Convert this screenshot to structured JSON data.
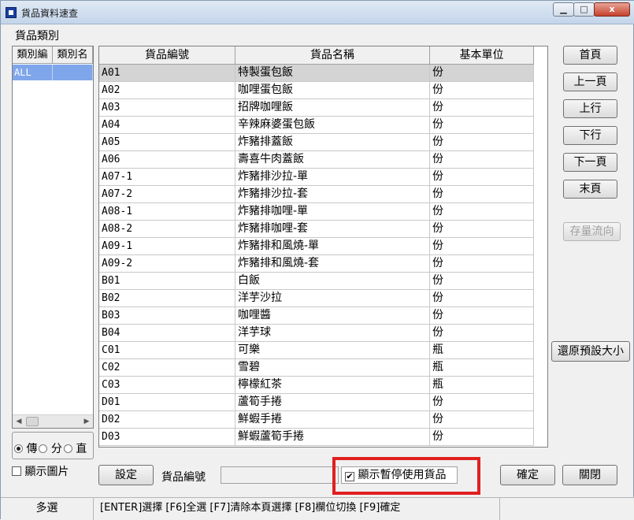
{
  "window": {
    "title": "貨品資料速查",
    "close_label": "x"
  },
  "category": {
    "label": "貨品類別",
    "columns": [
      "類別編",
      "類別名"
    ],
    "rows": [
      {
        "code": "ALL",
        "name": ""
      }
    ],
    "radio_options": [
      "傳",
      "分",
      "直"
    ],
    "show_picture_label": "顯示圖片"
  },
  "grid": {
    "columns": [
      "貨品編號",
      "貨品名稱",
      "基本單位"
    ],
    "rows": [
      {
        "code": "A01",
        "name": "特製蛋包飯",
        "unit": "份"
      },
      {
        "code": "A02",
        "name": "咖哩蛋包飯",
        "unit": "份"
      },
      {
        "code": "A03",
        "name": "招牌咖哩飯",
        "unit": "份"
      },
      {
        "code": "A04",
        "name": "辛辣麻婆蛋包飯",
        "unit": "份"
      },
      {
        "code": "A05",
        "name": "炸豬排蓋飯",
        "unit": "份"
      },
      {
        "code": "A06",
        "name": "壽喜牛肉蓋飯",
        "unit": "份"
      },
      {
        "code": "A07-1",
        "name": "炸豬排沙拉-單",
        "unit": "份"
      },
      {
        "code": "A07-2",
        "name": "炸豬排沙拉-套",
        "unit": "份"
      },
      {
        "code": "A08-1",
        "name": "炸豬排咖哩-單",
        "unit": "份"
      },
      {
        "code": "A08-2",
        "name": "炸豬排咖哩-套",
        "unit": "份"
      },
      {
        "code": "A09-1",
        "name": "炸豬排和風燒-單",
        "unit": "份"
      },
      {
        "code": "A09-2",
        "name": "炸豬排和風燒-套",
        "unit": "份"
      },
      {
        "code": "B01",
        "name": "白飯",
        "unit": "份"
      },
      {
        "code": "B02",
        "name": "洋芋沙拉",
        "unit": "份"
      },
      {
        "code": "B03",
        "name": "咖哩醬",
        "unit": "份"
      },
      {
        "code": "B04",
        "name": "洋芋球",
        "unit": "份"
      },
      {
        "code": "C01",
        "name": "可樂",
        "unit": "瓶"
      },
      {
        "code": "C02",
        "name": "雪碧",
        "unit": "瓶"
      },
      {
        "code": "C03",
        "name": "檸檬紅茶",
        "unit": "瓶"
      },
      {
        "code": "D01",
        "name": "蘆筍手捲",
        "unit": "份"
      },
      {
        "code": "D02",
        "name": "鮮蝦手捲",
        "unit": "份"
      },
      {
        "code": "D03",
        "name": "鮮蝦蘆筍手捲",
        "unit": "份"
      }
    ]
  },
  "nav": {
    "first": "首頁",
    "prev_page": "上一頁",
    "prev_row": "上行",
    "next_row": "下行",
    "next_page": "下一頁",
    "last": "末頁",
    "stock_flow": "存量流向",
    "reset_size": "還原預設大小"
  },
  "bottom": {
    "settings": "設定",
    "code_label": "貨品編號",
    "code_value": "",
    "show_paused_label": "顯示暫停使用貨品",
    "confirm": "確定",
    "close": "關閉"
  },
  "status": {
    "left": "多選",
    "hint": "[ENTER]選擇 [F6]全選 [F7]清除本頁選擇 [F8]欄位切換 [F9]確定"
  },
  "colors": {
    "highlight": "#e02020",
    "selected_category": "#7fa6ea",
    "selected_row": "#d4d4d4"
  }
}
